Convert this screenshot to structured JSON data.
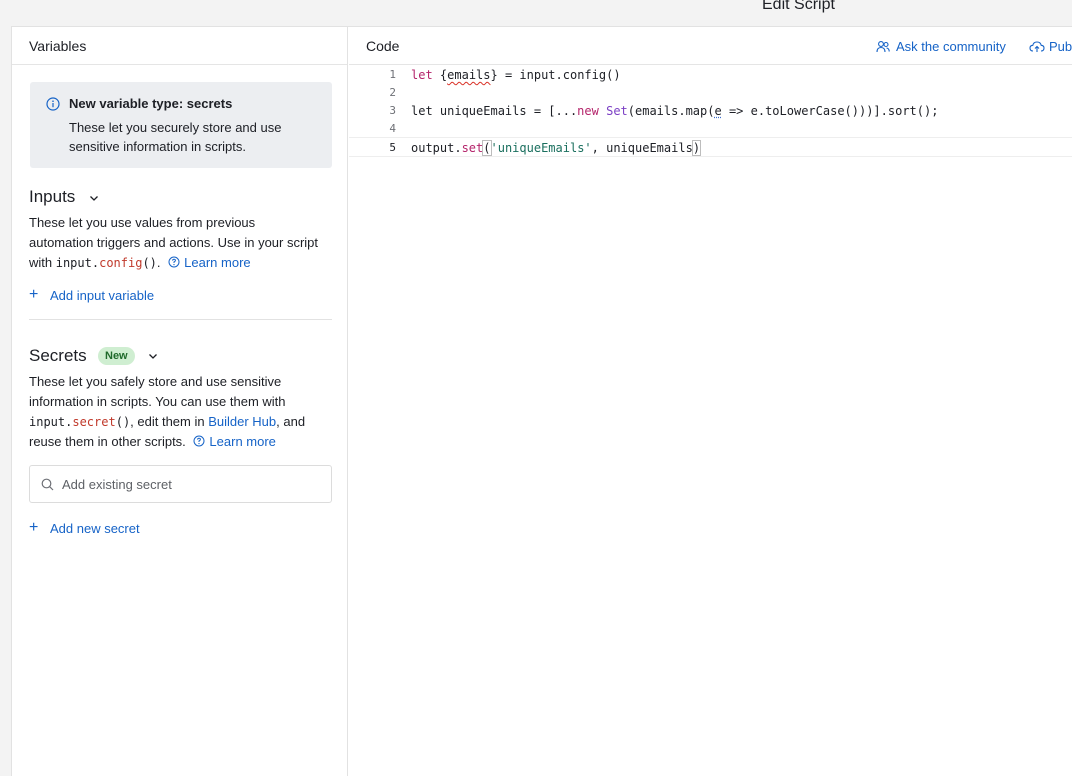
{
  "window_title": "Edit Script",
  "variables_panel": {
    "header": "Variables",
    "banner": {
      "title": "New variable type: secrets",
      "text": "These let you securely store and use sensitive information in scripts."
    },
    "inputs": {
      "title": "Inputs",
      "desc_prefix": "These let you use values from previous automation triggers and actions. Use in your script with ",
      "code_object": "input.",
      "code_method": "config",
      "code_parens": "()",
      "desc_suffix": ".",
      "learn_more": "Learn more",
      "add_label": "Add input variable"
    },
    "secrets": {
      "title": "Secrets",
      "badge": "New",
      "desc_prefix": "These let you safely store and use sensitive information in scripts. You can use them with ",
      "code_object": "input.",
      "code_method": "secret",
      "code_parens": "()",
      "desc_mid": ", edit them in ",
      "builder_hub": "Builder Hub",
      "desc_suffix": ", and reuse them in other scripts.",
      "learn_more": "Learn more",
      "search_placeholder": "Add existing secret",
      "add_label": "Add new secret"
    }
  },
  "code_panel": {
    "header": "Code",
    "ask_community": "Ask the community",
    "publish_truncated": "Pub",
    "lines": [
      {
        "number": "1",
        "tokens": {
          "a": "let ",
          "b": "{",
          "c": "emails",
          "d": "} = input.config()"
        }
      },
      {
        "number": "2"
      },
      {
        "number": "3",
        "tokens": {
          "a": "let uniqueEmails = [...",
          "b": "new",
          "c": " ",
          "d": "Set",
          "e": "(emails.map(",
          "f": "e",
          "g": " => e.toLowerCase()))].sort();"
        }
      },
      {
        "number": "4"
      },
      {
        "number": "5",
        "tokens": {
          "a": "output.",
          "b": "set",
          "c": "(",
          "d": "'uniqueEmails'",
          "e": ", uniqueEmails",
          "f": ")"
        }
      }
    ],
    "active_line": 5
  }
}
